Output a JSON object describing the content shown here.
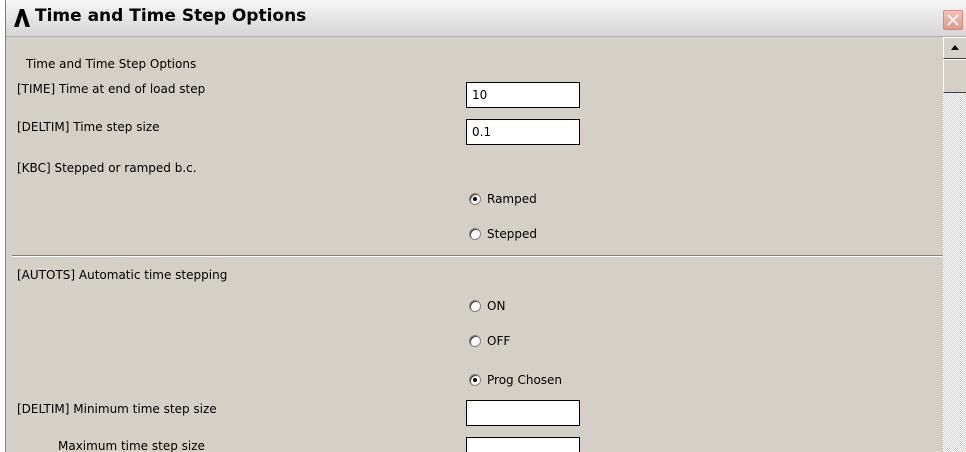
{
  "window": {
    "title": "Time and Time Step Options"
  },
  "content": {
    "heading": "Time and Time Step Options",
    "time_label": "[TIME]  Time at end of load step",
    "time_value": "10",
    "deltim_label": "[DELTIM]  Time step size",
    "deltim_value": "0.1",
    "kbc_label": "[KBC]     Stepped or ramped b.c.",
    "kbc_options": [
      {
        "label": "Ramped",
        "selected": true
      },
      {
        "label": "Stepped",
        "selected": false
      }
    ],
    "autots_label": "[AUTOTS] Automatic time stepping",
    "autots_options": [
      {
        "label": "ON",
        "selected": false
      },
      {
        "label": "OFF",
        "selected": false
      },
      {
        "label": "Prog Chosen",
        "selected": true
      }
    ],
    "min_step_label": "[DELTIM] Minimum time step size",
    "min_step_value": "",
    "max_step_label": "Maximum time step size",
    "max_step_value": ""
  },
  "icons": {
    "logo": "ansys-logo-icon",
    "close": "close-icon",
    "scroll_up": "arrow-up-icon"
  }
}
